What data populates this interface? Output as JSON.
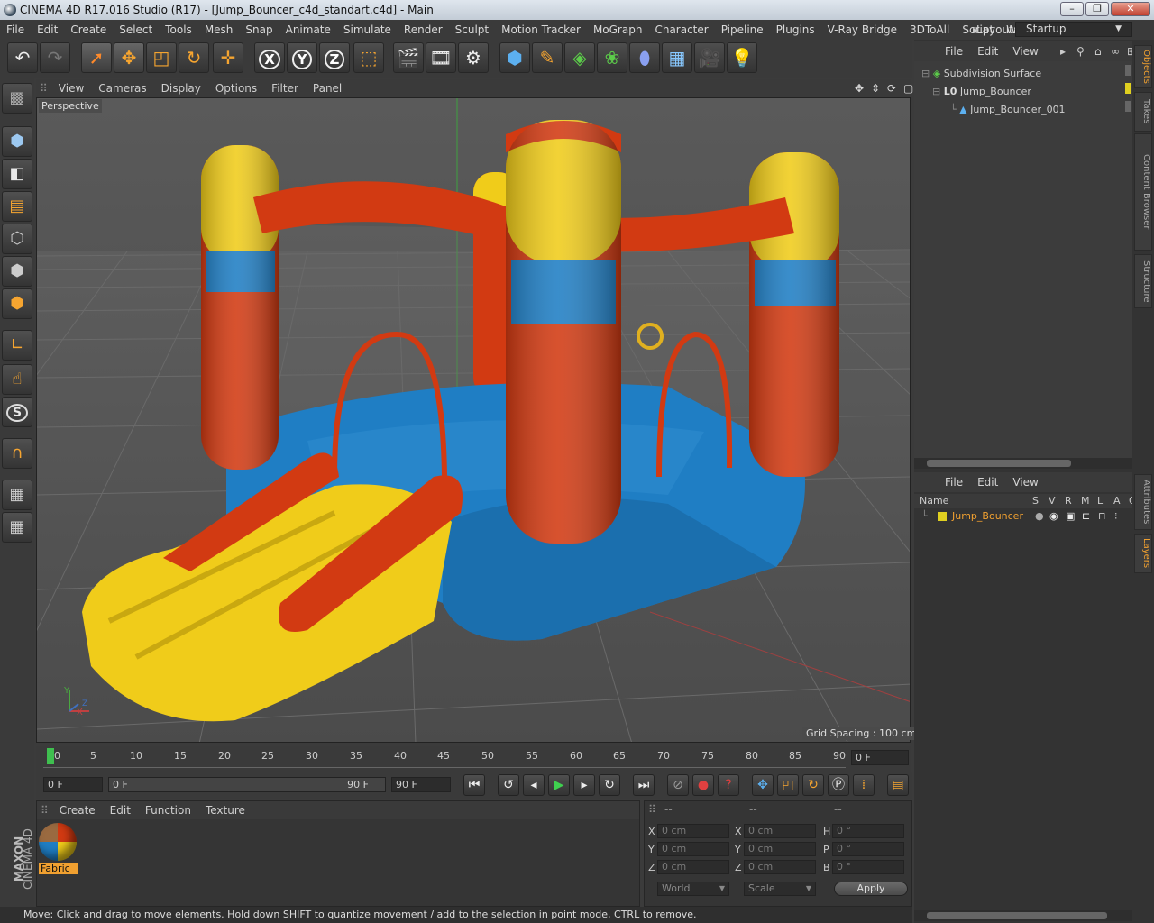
{
  "window": {
    "title": "CINEMA 4D R17.016 Studio (R17) - [Jump_Bouncer_c4d_standart.c4d] - Main",
    "buttons": [
      "–",
      "❐",
      "✕"
    ]
  },
  "menubar": [
    "File",
    "Edit",
    "Create",
    "Select",
    "Tools",
    "Mesh",
    "Snap",
    "Animate",
    "Simulate",
    "Render",
    "Sculpt",
    "Motion Tracker",
    "MoGraph",
    "Character",
    "Pipeline",
    "Plugins",
    "V-Ray Bridge",
    "3DToAll",
    "Script",
    "Window"
  ],
  "layout": {
    "label": "Layout:",
    "value": "Startup"
  },
  "toolbar": {
    "icons": [
      "undo-icon",
      "redo-icon",
      "select-arrow-icon",
      "move-icon",
      "scale-icon",
      "rotate-icon",
      "recent-tool-icon",
      "x-axis-icon",
      "y-axis-icon",
      "z-axis-icon",
      "coordinate-system-icon",
      "render-view-icon",
      "render-picture-viewer-icon",
      "render-settings-icon",
      "cube-icon",
      "pen-icon",
      "subdivision-icon",
      "cloner-icon",
      "deformer-icon",
      "floor-icon",
      "camera-icon",
      "light-icon"
    ],
    "axis_labels": [
      "X",
      "Y",
      "Z"
    ]
  },
  "left_tools": [
    "make-editable-icon",
    "model-mode-icon",
    "texture-mode-icon",
    "points-mode-icon",
    "edges-mode-icon",
    "polygons-mode-icon",
    "axis-mode-icon",
    "tweak-icon",
    "snap-s-icon",
    "magnet-icon",
    "workplane-lock-icon",
    "workplane-icon"
  ],
  "snap_letter": "S",
  "viewport": {
    "menu": [
      "View",
      "Cameras",
      "Display",
      "Options",
      "Filter",
      "Panel"
    ],
    "label": "Perspective",
    "grid_spacing": "Grid Spacing : 100 cm",
    "axis_labels": {
      "y": "Y",
      "x": "X",
      "z": "Z"
    }
  },
  "timeline": {
    "ticks": [
      "0",
      "5",
      "10",
      "15",
      "20",
      "25",
      "30",
      "35",
      "40",
      "45",
      "50",
      "55",
      "60",
      "65",
      "70",
      "75",
      "80",
      "85",
      "90"
    ],
    "current_frame": "0 F"
  },
  "anim": {
    "start": "0 F",
    "range_start": "0 F",
    "range_end": "90 F",
    "end": "90 F"
  },
  "material_panel": {
    "menu": [
      "Create",
      "Edit",
      "Function",
      "Texture"
    ],
    "materials": [
      {
        "name": "Fabric"
      }
    ]
  },
  "coordinates": {
    "headers": [
      "--",
      "--",
      "--"
    ],
    "rows": [
      {
        "l1": "X",
        "v1": "0 cm",
        "l2": "X",
        "v2": "0 cm",
        "l3": "H",
        "v3": "0 °"
      },
      {
        "l1": "Y",
        "v1": "0 cm",
        "l2": "Y",
        "v2": "0 cm",
        "l3": "P",
        "v3": "0 °"
      },
      {
        "l1": "Z",
        "v1": "0 cm",
        "l2": "Z",
        "v2": "0 cm",
        "l3": "B",
        "v3": "0 °"
      }
    ],
    "mode": "World",
    "transform": "Scale",
    "apply": "Apply"
  },
  "status": "Move: Click and drag to move elements. Hold down SHIFT to quantize movement / add to the selection in point mode, CTRL to remove.",
  "objects_panel": {
    "menu": [
      "File",
      "Edit",
      "View"
    ],
    "tree": [
      {
        "name": "Subdivision Surface",
        "depth": 0,
        "icon": "subdivision-icon"
      },
      {
        "name": "Jump_Bouncer",
        "depth": 1,
        "icon": "null-icon"
      },
      {
        "name": "Jump_Bouncer_001",
        "depth": 2,
        "icon": "polygon-object-icon"
      }
    ]
  },
  "layers_panel": {
    "menu": [
      "File",
      "Edit",
      "View"
    ],
    "columns": [
      "Name",
      "S",
      "V",
      "R",
      "M",
      "L",
      "A",
      "G"
    ],
    "rows": [
      {
        "name": "Jump_Bouncer",
        "color": "#e0d020"
      }
    ]
  },
  "side_tabs_top": [
    "Objects",
    "Takes",
    "Content Browser",
    "Structure"
  ],
  "side_tabs_bottom": [
    "Attributes",
    "Layers"
  ],
  "brand": {
    "maxon": "MAXON",
    "product": "CINEMA 4D"
  },
  "colors": {
    "accent": "#f0a030",
    "bouncer_red": "#d23a12",
    "bouncer_yellow": "#f0cc1a",
    "bouncer_blue": "#1f7ec4"
  }
}
